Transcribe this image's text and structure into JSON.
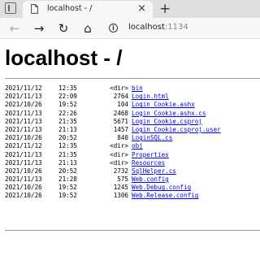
{
  "tab": {
    "title": "localhost - /",
    "close": "×"
  },
  "newtab": "+",
  "nav": {
    "back": "←",
    "forward": "→",
    "reload": "↻",
    "home": "⌂"
  },
  "url": {
    "host": "localhost",
    "port": ":1134"
  },
  "page": {
    "title": "localhost - /"
  },
  "entries": [
    {
      "date": "2021/11/12",
      "time": "12:35",
      "size": "<dir>",
      "name": "bin"
    },
    {
      "date": "2021/11/13",
      "time": "22:09",
      "size": "2764",
      "name": "Login.html"
    },
    {
      "date": "2021/10/26",
      "time": "19:52",
      "size": "104",
      "name": "Login_Cookie.ashx"
    },
    {
      "date": "2021/11/13",
      "time": "22:26",
      "size": "2468",
      "name": "Login_Cookie.ashx.cs"
    },
    {
      "date": "2021/11/13",
      "time": "21:35",
      "size": "5671",
      "name": "Login_Cookie.csproj"
    },
    {
      "date": "2021/11/13",
      "time": "21:13",
      "size": "1457",
      "name": "Login_Cookie.csproj.user"
    },
    {
      "date": "2021/10/26",
      "time": "20:52",
      "size": "840",
      "name": "LoginSQL.cs"
    },
    {
      "date": "2021/11/12",
      "time": "12:35",
      "size": "<dir>",
      "name": "obj"
    },
    {
      "date": "2021/11/13",
      "time": "21:35",
      "size": "<dir>",
      "name": "Properties"
    },
    {
      "date": "2021/11/13",
      "time": "21:13",
      "size": "<dir>",
      "name": "Resources"
    },
    {
      "date": "2021/10/26",
      "time": "20:52",
      "size": "2732",
      "name": "SqlHelper.cs"
    },
    {
      "date": "2021/11/13",
      "time": "21:28",
      "size": "575",
      "name": "Web.config"
    },
    {
      "date": "2021/10/26",
      "time": "19:52",
      "size": "1245",
      "name": "Web.Debug.config"
    },
    {
      "date": "2021/10/26",
      "time": "19:52",
      "size": "1306",
      "name": "Web.Release.config"
    }
  ]
}
